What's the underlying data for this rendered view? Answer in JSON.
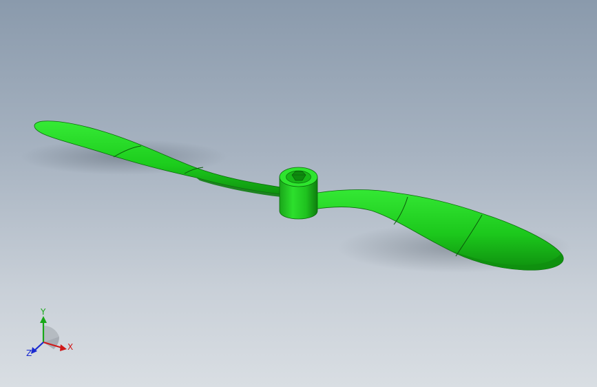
{
  "viewport": {
    "background_top": "#8a9aac",
    "background_bottom": "#d9dee3"
  },
  "model": {
    "name": "propeller",
    "color": "#1fd31f",
    "edge_color": "#0b6a0b"
  },
  "triad": {
    "x_label": "X",
    "y_label": "Y",
    "z_label": "Z",
    "x_color": "#d01818",
    "y_color": "#18a818",
    "z_color": "#1a2ad0"
  }
}
